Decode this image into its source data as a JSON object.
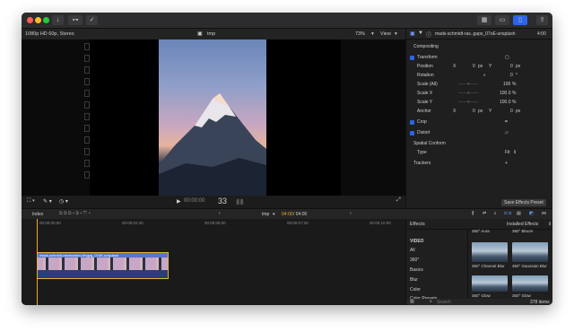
{
  "viewer": {
    "format": "1080p HD 60p, Stereo",
    "project": "tmp",
    "zoom": "73%",
    "view_menu": "View",
    "timecode": "00:00:00",
    "timecode_frames": "33"
  },
  "inspector": {
    "clip_name": "mads-schmidt-ras..gaps_07oE-unsplash",
    "duration": "4:00",
    "compositing": "Compositing",
    "transform": "Transform",
    "position": {
      "label": "Position",
      "x_label": "X",
      "x": "0",
      "x_unit": "px",
      "y_label": "Y",
      "y": "0",
      "y_unit": "px"
    },
    "rotation": {
      "label": "Rotation",
      "value": "0",
      "unit": "°"
    },
    "scale_all": {
      "label": "Scale (All)",
      "value": "100",
      "unit": "%"
    },
    "scale_x": {
      "label": "Scale X",
      "value": "100.0",
      "unit": "%"
    },
    "scale_y": {
      "label": "Scale Y",
      "value": "100.0",
      "unit": "%"
    },
    "anchor": {
      "label": "Anchor",
      "x_label": "X",
      "x": "0",
      "x_unit": "px",
      "y_label": "Y",
      "y": "0",
      "y_unit": "px"
    },
    "crop": "Crop",
    "distort": "Distort",
    "spatial_conform": "Spatial Conform",
    "type_label": "Type",
    "type_value": "Fit",
    "trackers": "Trackers",
    "trackers_add": "+",
    "save_preset": "Save Effects Preset"
  },
  "timeline_bar": {
    "index": "Index",
    "project": "tmp",
    "position": "04:00",
    "duration": "/ 04:00"
  },
  "ruler": [
    "00:00:00:00",
    "00:00:02:30",
    "00:00:05:00",
    "00:00:07:30",
    "00:00:10:00"
  ],
  "clip": {
    "label": "mads-schmidt-rasmussen-xIhgpg_07oE-unsplash"
  },
  "effects": {
    "title": "Effects",
    "installed": "Installed Effects",
    "categories": [
      "VIDEO",
      "All",
      "360°",
      "Basics",
      "Blur",
      "Color",
      "Color Presets"
    ],
    "top_labels": [
      "360° Aura",
      "360° Bloom"
    ],
    "items": [
      "360° Channel Blur",
      "360° Gaussian Blur",
      "360° Glow",
      "360° Glow"
    ],
    "search_placeholder": "Search",
    "count": "378 items"
  },
  "colors": {
    "accent": "#2d63e8",
    "clip_border": "#e6b23d",
    "playhead": "#f0a832"
  }
}
